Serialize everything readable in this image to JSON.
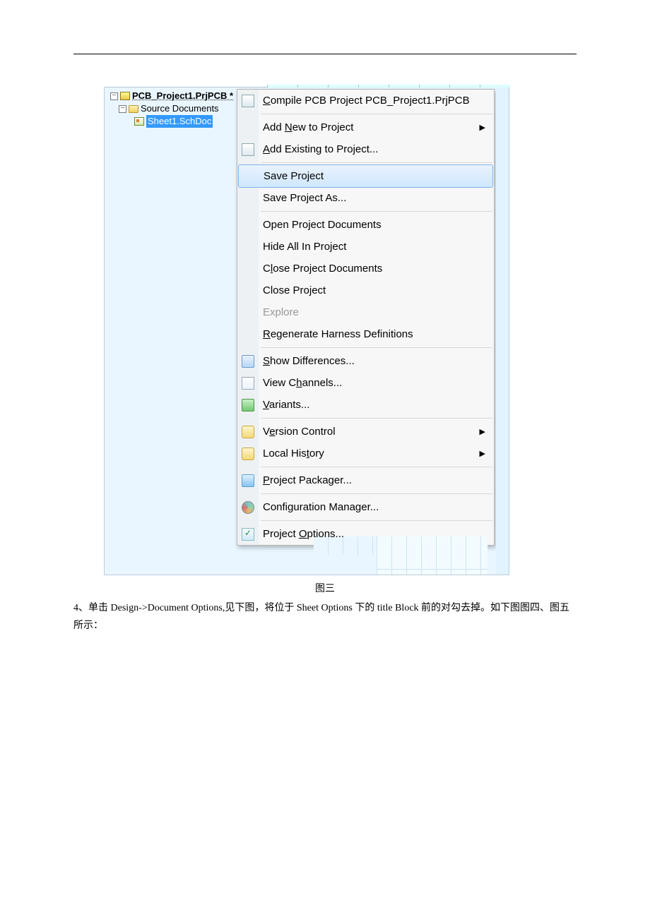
{
  "tree": {
    "root": "PCB_Project1.PrjPCB *",
    "folder": "Source Documents",
    "file": "Sheet1.SchDoc"
  },
  "menu": {
    "compile": "Compile PCB Project PCB_Project1.PrjPCB",
    "add_new": "Add New to Project",
    "add_existing": "Add Existing to Project...",
    "save": "Save Project",
    "save_as": "Save Project As...",
    "open_docs": "Open Project Documents",
    "hide_all": "Hide All In Project",
    "close_docs": "Close Project Documents",
    "close_prj": "Close Project",
    "explore": "Explore",
    "regen": "Regenerate Harness Definitions",
    "diff": "Show Differences...",
    "channels": "View Channels...",
    "variants": "Variants...",
    "vc": "Version Control",
    "hist": "Local History",
    "packager": "Project Packager...",
    "cfg": "Configuration Manager...",
    "options": "Project Options..."
  },
  "caption": "图三",
  "para": "4、单击 Design->Document Options,见下图，将位于 Sheet Options 下的 title Block 前的对勾去掉。如下图图四、图五所示："
}
